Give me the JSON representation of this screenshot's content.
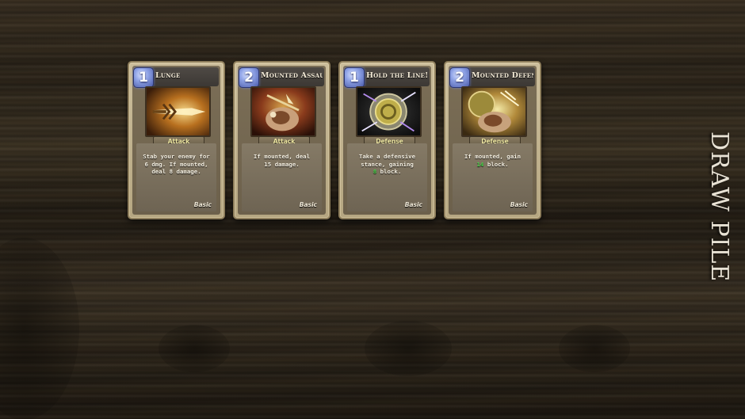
{
  "hand": {
    "cards": [
      {
        "cost": "1",
        "name": "Lunge",
        "type": "Attack",
        "rarity": "Basic",
        "desc_lines": [
          "Stab your enemy for",
          "6 dmg. If mounted,",
          "deal 8 damage."
        ],
        "art_icon": "lunge-spear-icon"
      },
      {
        "cost": "2",
        "name": "Mounted Assault",
        "type": "Attack",
        "rarity": "Basic",
        "desc_lines": [
          "If mounted, deal",
          "15 damage."
        ],
        "art_icon": "mounted-assault-icon"
      },
      {
        "cost": "1",
        "name": "Hold the Line!",
        "type": "Defense",
        "rarity": "Basic",
        "desc_lines": [
          "Take a defensive",
          "stance, gaining"
        ],
        "desc_value": "8",
        "desc_suffix": " block.",
        "art_icon": "shield-icon"
      },
      {
        "cost": "2",
        "name": "Mounted Defense",
        "type": "Defense",
        "rarity": "Basic",
        "desc_prefix": "If mounted, gain",
        "desc_value": "14",
        "desc_suffix": " block.",
        "art_icon": "mounted-defense-icon"
      }
    ]
  },
  "draw_pile": {
    "label": "DRAW PILE"
  },
  "colors": {
    "cost_badge": "#8ea2e6",
    "type_text": "#efe7a2",
    "highlight_number": "#4bd04b"
  }
}
